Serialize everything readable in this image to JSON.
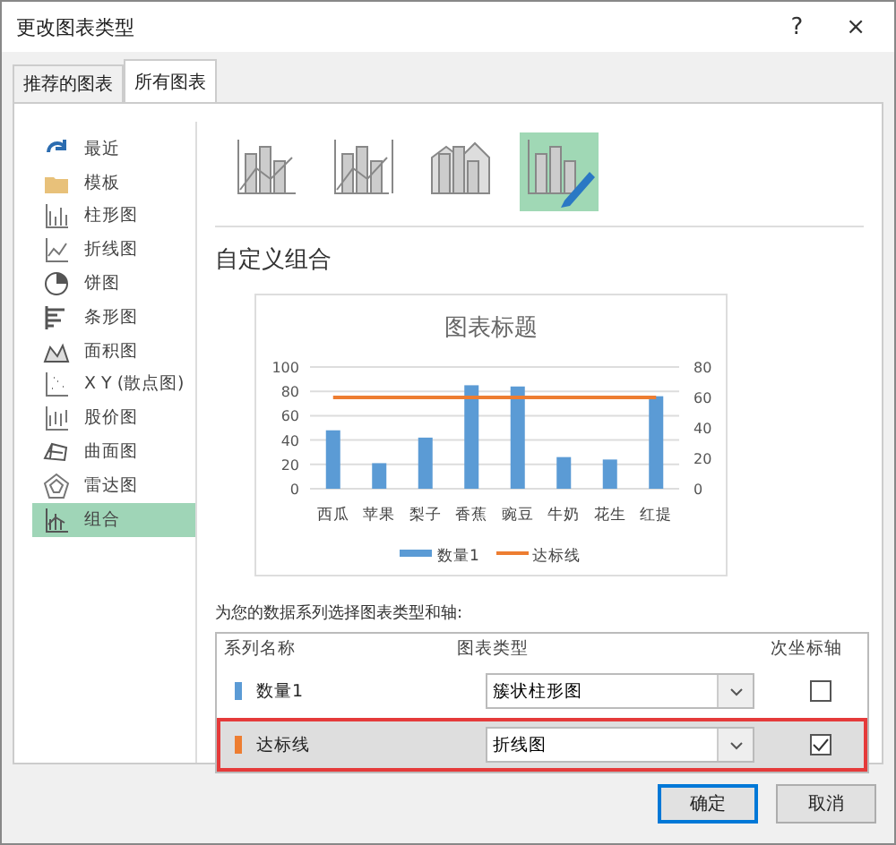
{
  "window": {
    "title": "更改图表类型",
    "help": "?",
    "close": "×"
  },
  "tabs": [
    {
      "label": "推荐的图表",
      "selected": false
    },
    {
      "label": "所有图表",
      "selected": true
    }
  ],
  "sidebar": {
    "items": [
      {
        "label": "最近",
        "selected": false
      },
      {
        "label": "模板",
        "selected": false
      },
      {
        "label": "柱形图",
        "selected": false
      },
      {
        "label": "折线图",
        "selected": false
      },
      {
        "label": "饼图",
        "selected": false
      },
      {
        "label": "条形图",
        "selected": false
      },
      {
        "label": "面积图",
        "selected": false
      },
      {
        "label": "X Y (散点图)",
        "selected": false
      },
      {
        "label": "股价图",
        "selected": false
      },
      {
        "label": "曲面图",
        "selected": false
      },
      {
        "label": "雷达图",
        "selected": false
      },
      {
        "label": "组合",
        "selected": true
      }
    ]
  },
  "subtypes": [
    {
      "selected": false
    },
    {
      "selected": false
    },
    {
      "selected": false
    },
    {
      "selected": true
    }
  ],
  "section_title": "自定义组合",
  "preview": {
    "chart_data": {
      "type": "bar",
      "title": "图表标题",
      "categories": [
        "西瓜",
        "苹果",
        "梨子",
        "香蕉",
        "豌豆",
        "牛奶",
        "花生",
        "红提"
      ],
      "series": [
        {
          "name": "数量1",
          "color": "#5b9bd5",
          "type": "bar",
          "values": [
            48,
            21,
            42,
            85,
            84,
            26,
            24,
            76
          ]
        },
        {
          "name": "达标线",
          "color": "#ed7d31",
          "type": "line",
          "axis": "y2",
          "values": [
            60,
            60,
            60,
            60,
            60,
            60,
            60,
            60
          ]
        }
      ],
      "grid": true,
      "legend": "bottom",
      "ylim": [
        0,
        100
      ],
      "yticks": [
        0,
        20,
        40,
        60,
        80,
        100
      ],
      "y2lim": [
        0,
        80
      ],
      "y2ticks": [
        0,
        20,
        40,
        60,
        80
      ]
    }
  },
  "series_prompt": "为您的数据系列选择图表类型和轴:",
  "series_table": {
    "columns": [
      "系列名称",
      "图表类型",
      "次坐标轴"
    ],
    "rows": [
      {
        "name": "数量1",
        "color": "#5b9bd5",
        "chart_type": "簇状柱形图",
        "secondary_axis": false,
        "selected": false
      },
      {
        "name": "达标线",
        "color": "#ed7d31",
        "chart_type": "折线图",
        "secondary_axis": true,
        "selected": true
      }
    ]
  },
  "buttons": [
    {
      "label": "确定",
      "kind": "primary"
    },
    {
      "label": "取消",
      "kind": "secondary"
    }
  ]
}
